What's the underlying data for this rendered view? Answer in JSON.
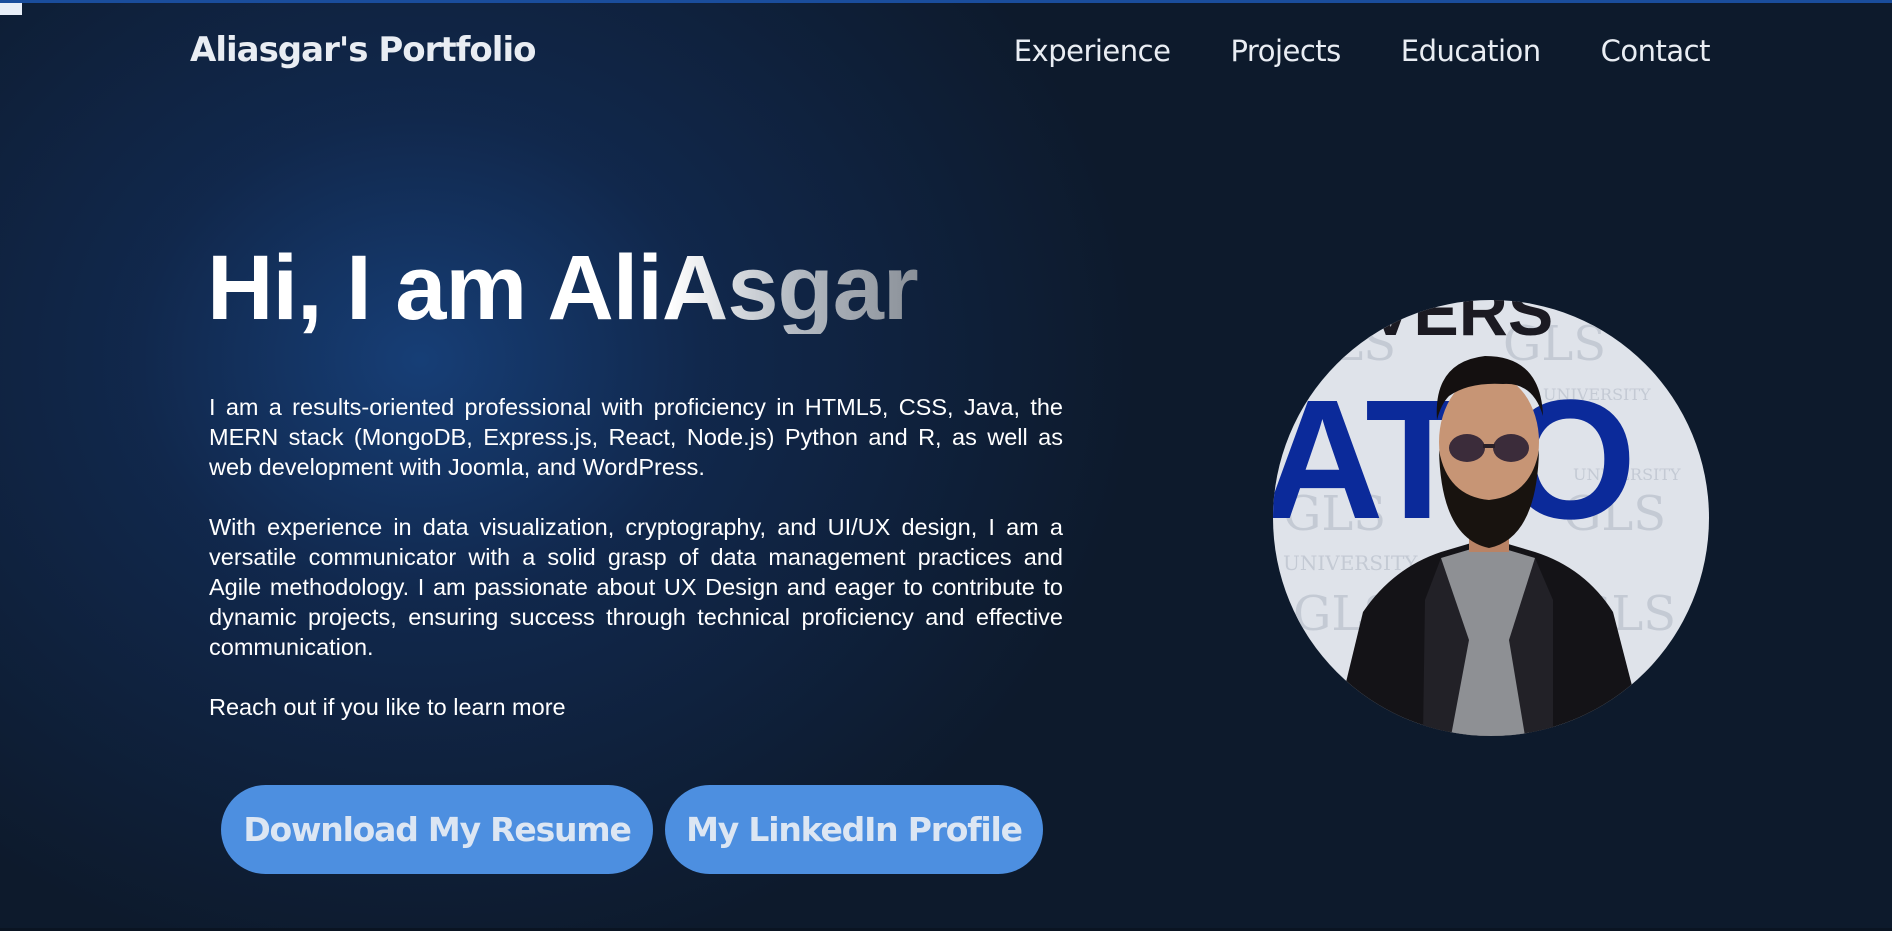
{
  "header": {
    "brand": "Aliasgar's Portfolio",
    "nav": [
      {
        "label": "Experience"
      },
      {
        "label": "Projects"
      },
      {
        "label": "Education"
      },
      {
        "label": "Contact"
      }
    ]
  },
  "hero": {
    "title": "Hi, I am AliAsgar",
    "paragraphs": [
      "I am a results-oriented professional with proficiency in HTML5, CSS, Java, the MERN stack (MongoDB, Express.js, React, Node.js) Python and R, as well as web development with Joomla, and WordPress.",
      "With experience in data visualization, cryptography, and UI/UX design, I am a versatile communicator with a solid grasp of data management practices and Agile methodology. I am passionate about UX Design and eager to contribute to dynamic projects, ensuring success through technical proficiency and effective communication.",
      "Reach out if you like to learn more"
    ],
    "buttons": {
      "resume": "Download My Resume",
      "linkedin": "My LinkedIn Profile"
    }
  },
  "profile_photo": {
    "backdrop_letters": [
      "ATIO",
      "VERS"
    ],
    "backdrop_text": [
      "GLS",
      "UNIVERSITY"
    ]
  },
  "colors": {
    "background": "#0d1a2c",
    "glow": "#17407a",
    "button": "#4d8fe0",
    "button_text": "#dce6f3",
    "text": "#ffffff"
  }
}
